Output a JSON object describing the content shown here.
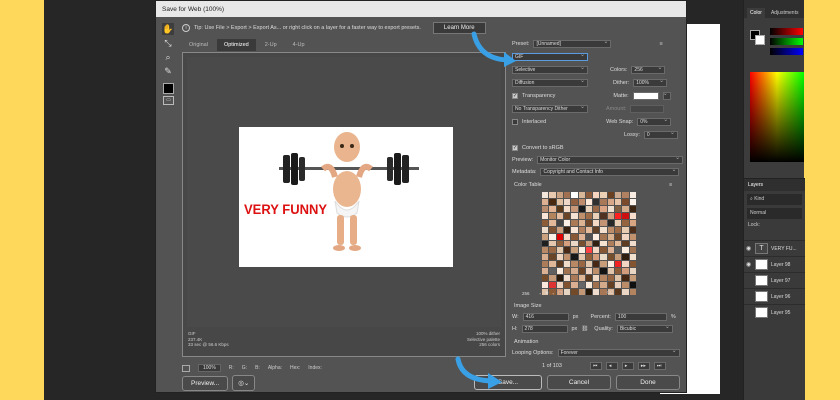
{
  "dialog": {
    "title": "Save for Web (100%)",
    "tip": "Tip: Use File > Export > Export As... or right click on a layer for a faster way to export presets.",
    "learn_more": "Learn More",
    "tabs": [
      "Original",
      "Optimized",
      "2-Up",
      "4-Up"
    ],
    "active_tab": "Optimized",
    "preview_info_left": [
      "GIF",
      "237.4K",
      "33 sec @ 56.6 Kbps"
    ],
    "preview_info_right": [
      "100% dither",
      "Selective palette",
      "256 colors"
    ],
    "image_text": "VERY FUNNY",
    "zoom": "100%",
    "status": {
      "r": "R:",
      "g": "G:",
      "b": "B:",
      "alpha": "Alpha:",
      "hex": "Hex:",
      "index": "Index:"
    },
    "buttons": {
      "preview": "Preview...",
      "save": "Save...",
      "cancel": "Cancel",
      "done": "Done"
    }
  },
  "settings": {
    "preset_label": "Preset:",
    "preset_value": "[Unnamed]",
    "format": "GIF",
    "reduction": "Selective",
    "colors_label": "Colors:",
    "colors_value": "256",
    "dither_algo": "Diffusion",
    "dither_label": "Dither:",
    "dither_value": "100%",
    "transparency_label": "Transparency",
    "matte_label": "Matte:",
    "transparency_dither": "No Transparency Dither",
    "amount_label": "Amount:",
    "interlaced_label": "Interlaced",
    "websnap_label": "Web Snap:",
    "websnap_value": "0%",
    "lossy_label": "Lossy:",
    "lossy_value": "0",
    "convert_srgb_label": "Convert to sRGB",
    "preview_label": "Preview:",
    "preview_value": "Monitor Color",
    "metadata_label": "Metadata:",
    "metadata_value": "Copyright and Contact Info",
    "color_table_label": "Color Table",
    "color_count": "256",
    "image_size_label": "Image Size",
    "w_label": "W:",
    "w_value": "416",
    "h_label": "H:",
    "h_value": "278",
    "px": "px",
    "percent_label": "Percent:",
    "percent_value": "100",
    "percent_unit": "%",
    "quality_label": "Quality:",
    "quality_value": "Bicubic",
    "animation_label": "Animation",
    "looping_label": "Looping Options:",
    "looping_value": "Forever",
    "frame_counter": "1 of 103"
  },
  "panels": {
    "color_tab": "Color",
    "adjustments_tab": "Adjustments",
    "layers_title": "Layers",
    "kind": "Kind",
    "blend": "Normal",
    "lock_label": "Lock:",
    "layers": [
      "VERY FU...",
      "Layer 98",
      "Layer 97",
      "Layer 96",
      "Layer 95"
    ]
  },
  "colors": {
    "dialog_bg": "#535353",
    "accent_arrow": "#3aa0e6",
    "image_text": "#d11111"
  },
  "color_table_swatches": [
    "#f2e6dc",
    "#e8c9b0",
    "#c9a080",
    "#a07050",
    "#ffffff",
    "#d9b89a",
    "#8a5a3a",
    "#f5d5c0",
    "#ebd0b5",
    "#6b4020",
    "#ccaa90",
    "#b08060",
    "#f8ece2",
    "#dcb090",
    "#4a2810",
    "#e0c0a0",
    "#f0d8c8",
    "#906040",
    "#c08c6c",
    "#ffe8d8",
    "#303030",
    "#a87858",
    "#d8a888",
    "#e8c4a8",
    "#7a4a2a",
    "#fff4ec",
    "#b88c6c",
    "#e4b494",
    "#5a3818",
    "#f4dcc8",
    "#c89878",
    "#1a1a1a",
    "#ecd4bc",
    "#986848",
    "#dca484",
    "#f0e0d0",
    "#806040",
    "#d4ac8c",
    "#3c2410",
    "#fae6d8",
    "#b4845c",
    "#e6bca0",
    "#6a4424",
    "#f6e2d2",
    "#c0906c",
    "#a06c48",
    "#ead0b8",
    "#503020",
    "#d0a080",
    "#ff2020",
    "#cc1010",
    "#f8dccc",
    "#8c5c38",
    "#e2b898",
    "#444444",
    "#fbeee4",
    "#aa7a58",
    "#dcb494",
    "#72482a",
    "#f2dac6",
    "#c49474",
    "#282828",
    "#e8ccb4",
    "#94643e",
    "#d8a482",
    "#eeddcc",
    "#7c5232",
    "#caa080",
    "#362010",
    "#f8e4d6",
    "#b0805e",
    "#e4bc9c",
    "#624026",
    "#f4e0ce",
    "#bc8c68",
    "#9c6a46",
    "#e6ccb2",
    "#4c2e1a",
    "#cca27e",
    "#fdf0e6",
    "#e00000",
    "#f6d8c6",
    "#885836",
    "#e0b496",
    "#505050",
    "#fceee2",
    "#a47654",
    "#dab290",
    "#6e4628",
    "#f0d6c2",
    "#c2926e",
    "#202020",
    "#e6c8ae",
    "#90603c",
    "#d6a080",
    "#ecd8c6",
    "#78502e",
    "#c89e7c",
    "#322010",
    "#f6e2d0",
    "#ae7e5c",
    "#e2ba9a",
    "#5e3c22",
    "#f2dccc",
    "#ba8a66",
    "#9a6844",
    "#e4c8ae",
    "#482a16",
    "#caa07c",
    "#fdeee2",
    "#ff4040",
    "#f4d6c4",
    "#845634",
    "#deb294",
    "#5a5a5a",
    "#fbece0",
    "#a27452",
    "#d8ae8e",
    "#6a4426",
    "#eed4c0",
    "#c0906c",
    "#181818",
    "#e4c6ac",
    "#8e5e3a",
    "#d49e7e",
    "#eadac8",
    "#764e2c",
    "#c69c7a",
    "#2e1c0e",
    "#f4e0ce",
    "#ac7c5a",
    "#e0b898",
    "#5c3a20",
    "#f0dac8",
    "#b88864",
    "#986642",
    "#e2c6ac",
    "#462814",
    "#c89e7a",
    "#fcece0",
    "#ee2222",
    "#f2d4c2",
    "#825432",
    "#dcb092",
    "#606060",
    "#faeadc",
    "#a07250",
    "#d6ac8c",
    "#684224",
    "#ecd2be",
    "#be8e6a",
    "#141414",
    "#e2c4aa",
    "#8c5c38",
    "#d29c7c",
    "#e8d6c4",
    "#744c2a",
    "#c49a78",
    "#2a1a0c",
    "#f2dece",
    "#aa7a58",
    "#deb696",
    "#5a381e",
    "#eed8c6",
    "#b68662",
    "#966440",
    "#e0c4aa",
    "#442612",
    "#c69c78",
    "#fae8dc",
    "#dd3333",
    "#f0d2c0",
    "#805230",
    "#daae90",
    "#666666",
    "#f8e8da",
    "#9e704e",
    "#d4aa8a",
    "#664022",
    "#ead0bc",
    "#bc8c68",
    "#101010",
    "#e0c2a8",
    "#8a5a36",
    "#d09a7a",
    "#e6d4c2",
    "#724a28",
    "#c29876",
    "#261808",
    "#f0dccc",
    "#a87856",
    "#dcb494",
    "#58361c",
    "#ecd6c4",
    "#b48460",
    "#94623e",
    "#dec2a8",
    "#402410",
    "#c49a76",
    "#f8e6da",
    "#cc2222",
    "#eed0be",
    "#7e502e",
    "#d8ac8e",
    "#707070",
    "#f6e6d8",
    "#9c6e4c",
    "#d2a888",
    "#643e20",
    "#e8cebA",
    "#ba8a66",
    "#0c0c0c",
    "#dec0a6",
    "#885834",
    "#ce9878",
    "#e4d2c0",
    "#704826",
    "#c09674",
    "#221606",
    "#eedaca",
    "#a67654",
    "#dab292",
    "#56341a",
    "#ead4c2",
    "#b2825e",
    "#92603c",
    "#dcc0a6",
    "#3e220e",
    "#c29874",
    "#f6e4d8",
    "#bb2020"
  ]
}
